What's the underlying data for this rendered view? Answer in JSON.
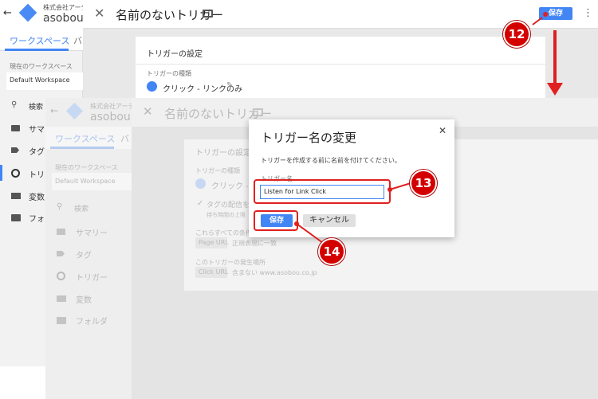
{
  "back": {
    "company": "株式会社アーデ",
    "container": "asobou.co",
    "tab_workspace": "ワークスペース",
    "tab_second": "バ",
    "workspace_label": "現在のワークスペース",
    "workspace_value": "Default Workspace",
    "search": "検索",
    "nav": [
      "サマリ",
      "タグ",
      "トリガ",
      "変数",
      "フォル"
    ],
    "title": "名前のないトリガー",
    "save": "保存",
    "card_title": "トリガーの設定",
    "trigger_type_label": "トリガーの種類",
    "trigger_type_value": "クリック - リンクのみ"
  },
  "middle": {
    "company": "株式会社アーデ",
    "container": "asobou.co",
    "tab_workspace": "ワークスペース",
    "tab_second": "バ",
    "workspace_label": "現在のワークスペース",
    "workspace_value": "Default Workspace",
    "search": "検索",
    "nav": [
      "サマリー",
      "タグ",
      "トリガー",
      "変数",
      "フォルダ"
    ],
    "title": "名前のないトリガー",
    "card_title": "トリガーの設定",
    "trigger_type_label": "トリガーの種類",
    "trigger_type_value": "クリック - リ",
    "wait_tags": "タグの配信を待",
    "wait_time": "待ち時間の上限",
    "conditions": "これらすべての条件が",
    "page_url": "Page URL",
    "regex": "正規表現に一致",
    "fire_on": "このトリガーの発生場所",
    "click_url": "Click URL",
    "contains": "含まない www.asobou.co.jp"
  },
  "dialog": {
    "title": "トリガー名の変更",
    "description": "トリガーを作成する前に名前を付けてください。",
    "field_label": "トリガー名",
    "field_value": "Listen for Link Click",
    "save": "保存",
    "cancel": "キャンセル"
  },
  "steps": [
    "12",
    "13",
    "14"
  ],
  "colors": {
    "accent": "#4285f4",
    "callout": "#e02020",
    "badge": "#d40000"
  }
}
